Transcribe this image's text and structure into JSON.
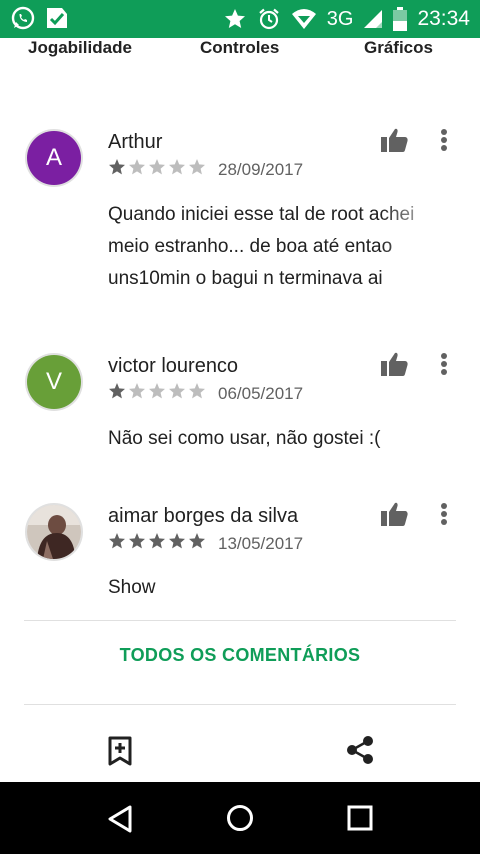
{
  "status_bar": {
    "network": "3G",
    "time": "23:34",
    "icons": [
      "whatsapp-icon",
      "notification-check-icon",
      "star-icon",
      "alarm-icon",
      "wifi-icon",
      "signal-icon",
      "battery-icon"
    ]
  },
  "tags": [
    "Jogabilidade",
    "Controles",
    "Gráficos"
  ],
  "reviews": [
    {
      "avatar_letter": "A",
      "avatar_color": "#7b1fa2",
      "name": "Arthur",
      "rating": 1,
      "date": "28/09/2017",
      "text_lines": [
        "Quando iniciei esse tal de root achei",
        "meio estranho... de boa até entao",
        "uns10min o bagui n terminava ai"
      ]
    },
    {
      "avatar_letter": "V",
      "avatar_color": "#689f38",
      "name": "victor lourenco",
      "rating": 1,
      "date": "06/05/2017",
      "text_lines": [
        "Não sei como usar, não gostei :("
      ]
    },
    {
      "avatar_letter": "",
      "avatar_color": "#5d4037",
      "name": "aimar borges da silva",
      "rating": 5,
      "date": "13/05/2017",
      "text_lines": [
        "Show"
      ]
    }
  ],
  "all_comments_label": "TODOS OS COMENTÁRIOS",
  "colors": {
    "accent": "#0f9d58",
    "star_filled": "#616161",
    "star_empty": "#bdbdbd"
  }
}
